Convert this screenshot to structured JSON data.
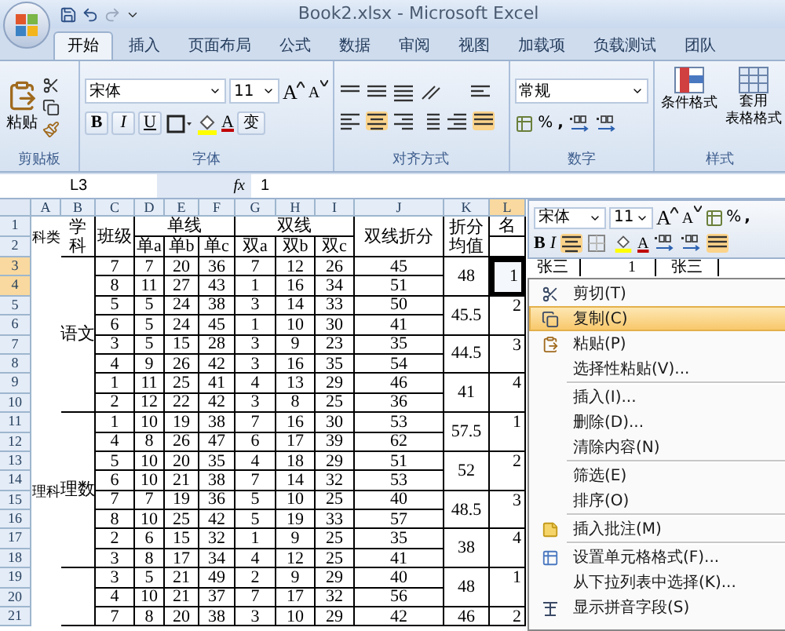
{
  "window": {
    "title": "Book2.xlsx - Microsoft Excel"
  },
  "tabs": [
    {
      "label": "开始",
      "selected": true
    },
    {
      "label": "插入",
      "selected": false
    },
    {
      "label": "页面布局",
      "selected": false
    },
    {
      "label": "公式",
      "selected": false
    },
    {
      "label": "数据",
      "selected": false
    },
    {
      "label": "审阅",
      "selected": false
    },
    {
      "label": "视图",
      "selected": false
    },
    {
      "label": "加载项",
      "selected": false
    },
    {
      "label": "负载测试",
      "selected": false
    },
    {
      "label": "团队",
      "selected": false
    }
  ],
  "ribbon": {
    "clipboard": {
      "label": "剪贴板",
      "paste": "粘贴"
    },
    "font": {
      "label": "字体",
      "font_name": "宋体",
      "font_size": "11",
      "grow": "A",
      "shrink": "A",
      "bold": "B",
      "italic": "I",
      "underline": "U",
      "font_color": "A",
      "phonetic": "变"
    },
    "alignment": {
      "label": "对齐方式"
    },
    "number": {
      "label": "数字",
      "format": "常规",
      "percent": "%",
      "comma": ","
    },
    "styles": {
      "label": "样式",
      "conditional": "条件格式",
      "table_format": [
        "套用",
        "表格格式"
      ]
    }
  },
  "formula_bar": {
    "name_box": "L3",
    "function_label": "fx",
    "formula": "1"
  },
  "sheet": {
    "columns": [
      {
        "label": "A",
        "selected": false
      },
      {
        "label": "B",
        "selected": false
      },
      {
        "label": "C",
        "selected": false
      },
      {
        "label": "D",
        "selected": false
      },
      {
        "label": "E",
        "selected": false
      },
      {
        "label": "F",
        "selected": false
      },
      {
        "label": "G",
        "selected": false
      },
      {
        "label": "H",
        "selected": false
      },
      {
        "label": "I",
        "selected": false
      },
      {
        "label": "J",
        "selected": false
      },
      {
        "label": "K",
        "selected": false
      },
      {
        "label": "L",
        "selected": true
      }
    ],
    "row_headers": [
      {
        "label": "1",
        "selected": false
      },
      {
        "label": "2",
        "selected": false
      },
      {
        "label": "3",
        "selected": true
      },
      {
        "label": "4",
        "selected": true
      },
      {
        "label": "5",
        "selected": false
      },
      {
        "label": "6",
        "selected": false
      },
      {
        "label": "7",
        "selected": false
      },
      {
        "label": "8",
        "selected": false
      },
      {
        "label": "9",
        "selected": false
      },
      {
        "label": "10",
        "selected": false
      },
      {
        "label": "11",
        "selected": false
      },
      {
        "label": "12",
        "selected": false
      },
      {
        "label": "13",
        "selected": false
      },
      {
        "label": "14",
        "selected": false
      },
      {
        "label": "15",
        "selected": false
      },
      {
        "label": "16",
        "selected": false
      },
      {
        "label": "17",
        "selected": false
      },
      {
        "label": "18",
        "selected": false
      },
      {
        "label": "19",
        "selected": false
      },
      {
        "label": "20",
        "selected": false
      },
      {
        "label": "21",
        "selected": false
      }
    ],
    "header": {
      "category": "科类",
      "subject": "学科",
      "class": "班级",
      "single": "单线",
      "single_subs": [
        "单a",
        "单b",
        "单c"
      ],
      "double": "双线",
      "double_subs": [
        "双a",
        "双b",
        "双c"
      ],
      "score": "双线折分",
      "mean": "折分均值",
      "rank": "名"
    },
    "sections": [
      {
        "subject": "语文",
        "groups": [
          {
            "rows": [
              [
                "7",
                "7",
                "20",
                "36",
                "7",
                "12",
                "26",
                "45"
              ],
              [
                "8",
                "11",
                "27",
                "43",
                "1",
                "16",
                "34",
                "51"
              ]
            ],
            "mean": "48",
            "rank": "1",
            "selected": true,
            "extra": [
              "张三",
              "1",
              "张三"
            ]
          },
          {
            "rows": [
              [
                "5",
                "5",
                "24",
                "38",
                "3",
                "14",
                "33",
                "50"
              ],
              [
                "6",
                "5",
                "24",
                "45",
                "1",
                "10",
                "30",
                "41"
              ]
            ],
            "mean": "45.5",
            "rank": "2",
            "selected": false
          },
          {
            "rows": [
              [
                "3",
                "5",
                "15",
                "28",
                "3",
                "9",
                "23",
                "35"
              ],
              [
                "4",
                "9",
                "26",
                "42",
                "3",
                "16",
                "35",
                "54"
              ]
            ],
            "mean": "44.5",
            "rank": "3",
            "selected": false
          },
          {
            "rows": [
              [
                "1",
                "11",
                "25",
                "41",
                "4",
                "13",
                "29",
                "46"
              ],
              [
                "2",
                "12",
                "22",
                "42",
                "3",
                "8",
                "25",
                "36"
              ]
            ],
            "mean": "41",
            "rank": "4",
            "selected": false
          }
        ]
      },
      {
        "category": "理科",
        "subject": "理数",
        "groups": [
          {
            "rows": [
              [
                "1",
                "10",
                "19",
                "38",
                "7",
                "16",
                "30",
                "53"
              ],
              [
                "4",
                "8",
                "26",
                "47",
                "6",
                "17",
                "39",
                "62"
              ]
            ],
            "mean": "57.5",
            "rank": "1",
            "selected": false
          },
          {
            "rows": [
              [
                "5",
                "10",
                "20",
                "35",
                "4",
                "18",
                "29",
                "51"
              ],
              [
                "6",
                "10",
                "21",
                "38",
                "7",
                "14",
                "32",
                "53"
              ]
            ],
            "mean": "52",
            "rank": "2",
            "selected": false
          },
          {
            "rows": [
              [
                "7",
                "7",
                "19",
                "36",
                "5",
                "10",
                "25",
                "40"
              ],
              [
                "8",
                "10",
                "25",
                "42",
                "5",
                "19",
                "33",
                "57"
              ]
            ],
            "mean": "48.5",
            "rank": "3",
            "selected": false
          },
          {
            "rows": [
              [
                "2",
                "6",
                "15",
                "32",
                "1",
                "9",
                "25",
                "35"
              ],
              [
                "3",
                "8",
                "17",
                "34",
                "4",
                "12",
                "25",
                "41"
              ]
            ],
            "mean": "38",
            "rank": "4",
            "selected": false
          }
        ]
      },
      {
        "groups": [
          {
            "rows": [
              [
                "3",
                "5",
                "21",
                "49",
                "2",
                "9",
                "29",
                "40"
              ],
              [
                "4",
                "10",
                "21",
                "37",
                "7",
                "17",
                "32",
                "56"
              ]
            ],
            "mean": "48",
            "rank": "1",
            "selected": false
          },
          {
            "rows": [
              [
                "7",
                "8",
                "20",
                "38",
                "3",
                "10",
                "29",
                "42"
              ]
            ],
            "mean": "46",
            "rank": "2",
            "selected": false
          }
        ]
      }
    ]
  },
  "mini_toolbar": {
    "font_name": "宋体",
    "font_size": "11",
    "grow": "A",
    "shrink": "A",
    "percent": "%",
    "comma": ",",
    "bold": "B",
    "italic": "I",
    "font_color": "A"
  },
  "context_menu": [
    {
      "label": "剪切(T)",
      "kind": "cut",
      "selected": false,
      "separator_before": false
    },
    {
      "label": "复制(C)",
      "kind": "copy",
      "selected": true,
      "separator_before": false
    },
    {
      "label": "粘贴(P)",
      "kind": "paste",
      "selected": false,
      "separator_before": false
    },
    {
      "label": "选择性粘贴(V)...",
      "kind": "plain",
      "selected": false,
      "separator_before": false
    },
    {
      "label": "插入(I)...",
      "kind": "plain",
      "selected": false,
      "separator_before": true
    },
    {
      "label": "删除(D)...",
      "kind": "plain",
      "selected": false,
      "separator_before": false
    },
    {
      "label": "清除内容(N)",
      "kind": "plain",
      "selected": false,
      "separator_before": false
    },
    {
      "label": "筛选(E)",
      "kind": "plain",
      "selected": false,
      "separator_before": true
    },
    {
      "label": "排序(O)",
      "kind": "plain",
      "selected": false,
      "separator_before": false
    },
    {
      "label": "插入批注(M)",
      "kind": "note",
      "selected": false,
      "separator_before": true
    },
    {
      "label": "设置单元格格式(F)...",
      "kind": "format",
      "selected": false,
      "separator_before": true
    },
    {
      "label": "从下拉列表中选择(K)...",
      "kind": "plain",
      "selected": false,
      "separator_before": false
    },
    {
      "label": "显示拼音字段(S)",
      "kind": "phonetic",
      "selected": false,
      "separator_before": false
    }
  ]
}
